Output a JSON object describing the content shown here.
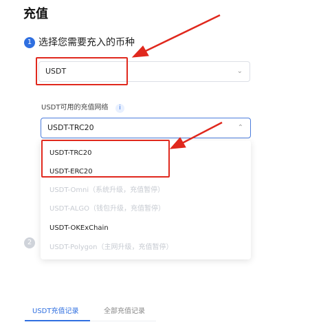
{
  "page": {
    "title": "充值"
  },
  "steps": [
    {
      "number": "1",
      "label": "选择您需要充入的币种"
    },
    {
      "number": "2"
    }
  ],
  "coin_select": {
    "value": "USDT",
    "icon": "chevron-down-icon"
  },
  "network": {
    "label": "USDT可用的充值网络",
    "info_icon": "info-icon",
    "info_glyph": "i",
    "value": "USDT-TRC20",
    "icon": "chevron-up-icon"
  },
  "dropdown_options": [
    {
      "label": "USDT-TRC20",
      "enabled": true
    },
    {
      "label": "USDT-ERC20",
      "enabled": true
    },
    {
      "label": "USDT-Omni（系统升级，充值暂停）",
      "enabled": false
    },
    {
      "label": "USDT-ALGO（钱包升级，充值暂停）",
      "enabled": false
    },
    {
      "label": "USDT-OKExChain",
      "enabled": true
    },
    {
      "label": "USDT-Polygon（主网升级，充值暂停）",
      "enabled": false
    }
  ],
  "tabs": [
    {
      "label": "USDT充值记录",
      "active": true
    },
    {
      "label": "全部充值记录",
      "active": false
    }
  ],
  "annotation_color": "#e0281d",
  "accent_color": "#2f6fe0"
}
